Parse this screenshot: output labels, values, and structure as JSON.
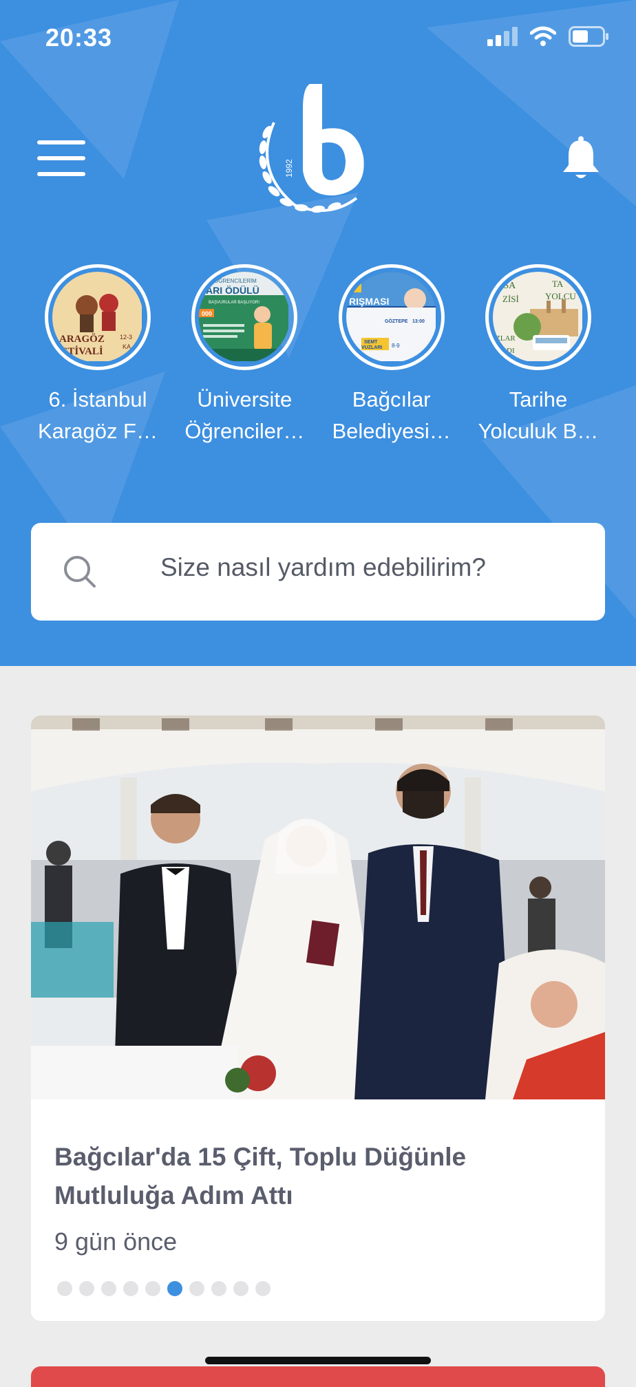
{
  "status_bar": {
    "time": "20:33"
  },
  "stories": [
    {
      "label_line1": "6. İstanbul",
      "label_line2": "Karagöz F…"
    },
    {
      "label_line1": "Üniversite",
      "label_line2": "Öğrenciler…"
    },
    {
      "label_line1": "Bağcılar",
      "label_line2": "Belediyesi…"
    },
    {
      "label_line1": "Tarihe",
      "label_line2": "Yolculuk B…"
    }
  ],
  "story_thumbnails": {
    "s1": {
      "line1": "ARAGÖZ",
      "line2": "STİVALİ",
      "line3": "12-3",
      "line4": "KA"
    },
    "s2": {
      "line1": "ÖĞRENCİLERİM",
      "line2": "ARI ÖDÜLÜ",
      "line3": "BAŞVURULAR BAŞLIYOR!",
      "line4": "000"
    },
    "s3": {
      "line1": "E",
      "line2": "RIŞMASI",
      "line3": "GÖZTEPE",
      "line4": "13:00",
      "line5": "SEMT",
      "line6": "VUZLARI",
      "line7": "8-9"
    },
    "s4": {
      "line1": "RSA",
      "line2": "ZİSİ",
      "line3": "TA",
      "line4": "YOLCU",
      "line5": "ZLAR",
      "line6": "DI"
    }
  },
  "search": {
    "placeholder": "Size nasıl yardım edebilirim?"
  },
  "news": {
    "title": "Bağcılar'da 15 Çift, Toplu Düğünle Mutluluğa Adım Attı",
    "time": "9 gün önce",
    "page_count": 10,
    "active_page": 6
  },
  "colors": {
    "header_blue": "#3d8fe0",
    "active_dot": "#3d8fe0",
    "inactive_dot": "#e3e3e6",
    "text_dark": "#5a5d6c"
  },
  "icons": [
    "menu-icon",
    "bell-icon",
    "search-icon",
    "signal-icon",
    "wifi-icon",
    "battery-icon",
    "logo"
  ]
}
